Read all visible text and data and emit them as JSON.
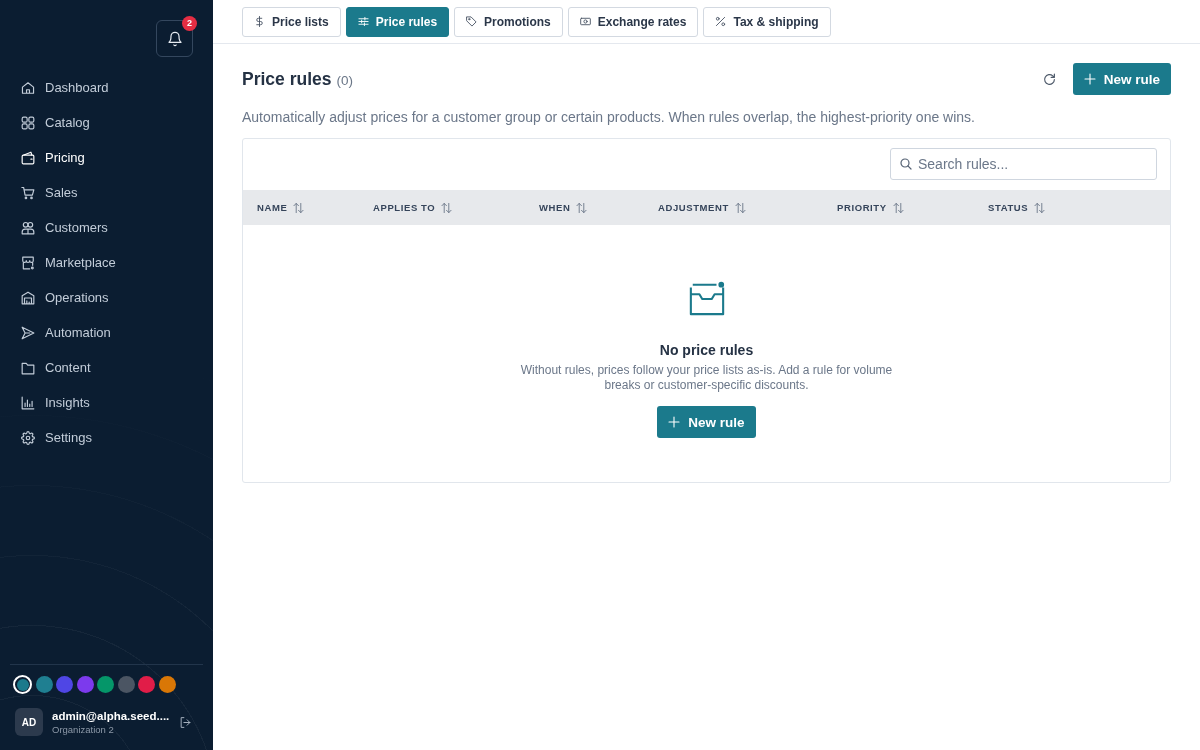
{
  "sidebar": {
    "notifications": {
      "badge": "2"
    },
    "items": [
      {
        "label": "Dashboard",
        "selected": false
      },
      {
        "label": "Catalog",
        "selected": false
      },
      {
        "label": "Pricing",
        "selected": true
      },
      {
        "label": "Sales",
        "selected": false
      },
      {
        "label": "Customers",
        "selected": false
      },
      {
        "label": "Marketplace",
        "selected": false
      },
      {
        "label": "Operations",
        "selected": false
      },
      {
        "label": "Automation",
        "selected": false
      },
      {
        "label": "Content",
        "selected": false
      },
      {
        "label": "Insights",
        "selected": false
      },
      {
        "label": "Settings",
        "selected": false
      }
    ],
    "color_swatches": [
      {
        "color": "#1b7a8c",
        "selected": true
      },
      {
        "color": "#1f7f91",
        "selected": false
      },
      {
        "color": "#4f46e5",
        "selected": false
      },
      {
        "color": "#7c3aed",
        "selected": false
      },
      {
        "color": "#059669",
        "selected": false
      },
      {
        "color": "#4b5563",
        "selected": false
      },
      {
        "color": "#e11d48",
        "selected": false
      },
      {
        "color": "#d97706",
        "selected": false
      }
    ],
    "user": {
      "initials": "AD",
      "name": "admin@alpha.seed....",
      "organization": "Organization 2"
    }
  },
  "tabs": [
    {
      "label": "Price lists",
      "selected": false
    },
    {
      "label": "Price rules",
      "selected": true
    },
    {
      "label": "Promotions",
      "selected": false
    },
    {
      "label": "Exchange rates",
      "selected": false
    },
    {
      "label": "Tax & shipping",
      "selected": false
    }
  ],
  "page": {
    "title": "Price rules",
    "count": "(0)",
    "new_button": "New rule",
    "description": "Automatically adjust prices for a customer group or certain products. When rules overlap, the highest-priority one wins."
  },
  "table": {
    "search": {
      "placeholder": "Search rules..."
    },
    "columns": [
      "NAME",
      "APPLIES TO",
      "WHEN",
      "ADJUSTMENT",
      "PRIORITY",
      "STATUS"
    ],
    "empty_state": {
      "title": "No price rules",
      "text": "Without rules, prices follow your price lists as-is. Add a rule for volume breaks or customer-specific discounts.",
      "button": "New rule"
    }
  }
}
